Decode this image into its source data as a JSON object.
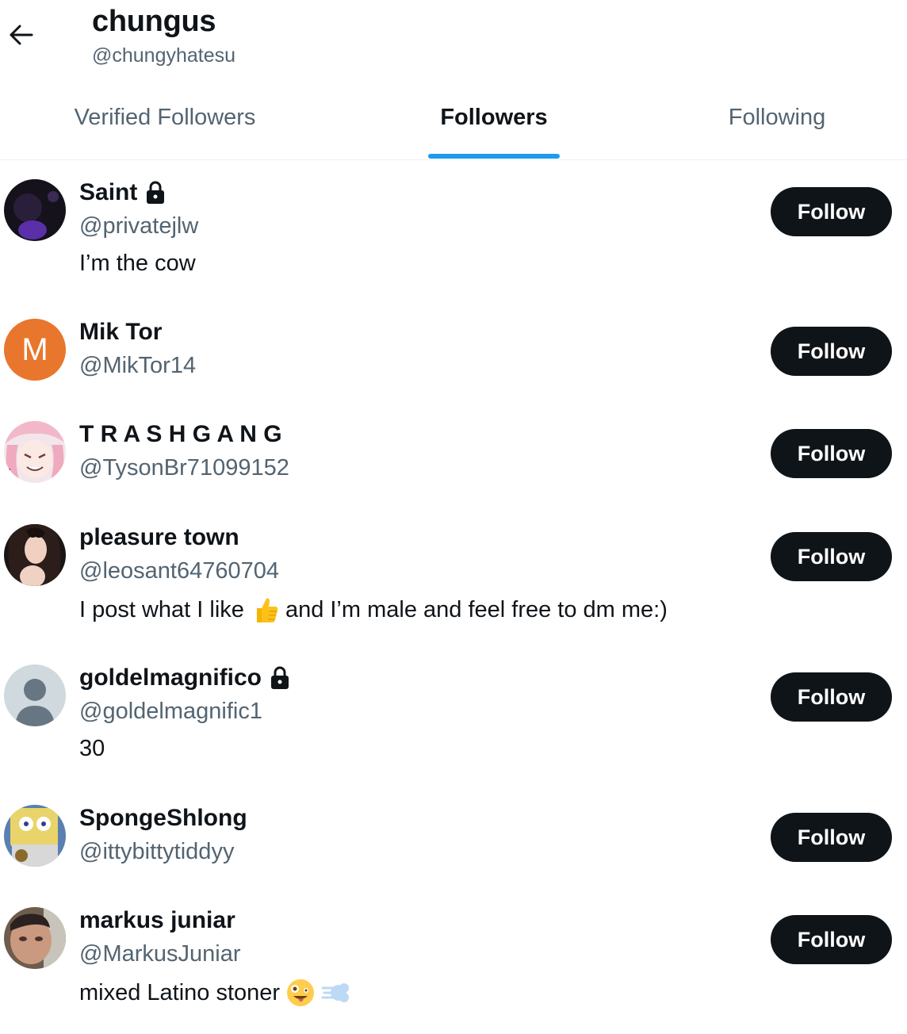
{
  "header": {
    "title": "chungus",
    "handle": "@chungyhatesu"
  },
  "tabs": [
    {
      "label": "Verified Followers",
      "active": false
    },
    {
      "label": "Followers",
      "active": true
    },
    {
      "label": "Following",
      "active": false
    }
  ],
  "follow_label": "Follow",
  "followers": [
    {
      "name": "Saint",
      "handle": "@privatejlw",
      "bio": "I’m the cow",
      "locked": true
    },
    {
      "name": "Mik Tor",
      "handle": "@MikTor14",
      "bio": "",
      "avatar_letter": "M",
      "avatar_color": "#e8762c"
    },
    {
      "name": "T R A S H G A N G",
      "handle": "@TysonBr71099152",
      "bio": ""
    },
    {
      "name": "pleasure town",
      "handle": "@leosant64760704",
      "bio_before": "I post what I like",
      "bio_after": "and I’m male and feel free to dm me:)",
      "bio_emoji": "thumbs-up-emoji"
    },
    {
      "name": "goldelmagnifico",
      "handle": "@goldelmagnific1",
      "bio": "30",
      "locked": true
    },
    {
      "name": "SpongeShlong",
      "handle": "@ittybittytiddyy",
      "bio": ""
    },
    {
      "name": "markus juniar",
      "handle": "@MarkusJuniar",
      "bio_before": "mixed Latino stoner",
      "bio_emoji": "zany-face-emoji",
      "bio_emoji2": "dashing-away-emoji"
    }
  ],
  "colors": {
    "accent": "#1d9bf0",
    "button": "#0f1419",
    "secondary_text": "#536471"
  }
}
